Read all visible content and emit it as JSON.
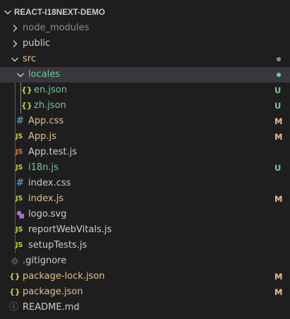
{
  "explorer": {
    "title": "REACT-I18NEXT-DEMO",
    "colors": {
      "modified": "#e2c08d",
      "untracked": "#73c991",
      "default": "#cccccc",
      "ignored": "#8c8c8c",
      "selection": "#37373d",
      "background": "#1e1e1e"
    },
    "items": [
      {
        "label": "node_modules",
        "type": "folder",
        "expanded": false,
        "icon": "chevron-right-icon",
        "status": ""
      },
      {
        "label": "public",
        "type": "folder",
        "expanded": false,
        "icon": "chevron-right-icon",
        "status": ""
      },
      {
        "label": "src",
        "type": "folder",
        "expanded": true,
        "icon": "chevron-down-icon",
        "status": "dot"
      },
      {
        "label": "locales",
        "type": "folder",
        "expanded": true,
        "icon": "chevron-down-icon",
        "status": "dot"
      },
      {
        "label": "en.json",
        "type": "file",
        "icon": "json-icon",
        "icon_text": "{}",
        "status": "U"
      },
      {
        "label": "zh.json",
        "type": "file",
        "icon": "json-icon",
        "icon_text": "{}",
        "status": "U"
      },
      {
        "label": "App.css",
        "type": "file",
        "icon": "css-icon",
        "icon_text": "#",
        "status": "M"
      },
      {
        "label": "App.js",
        "type": "file",
        "icon": "javascript-icon",
        "icon_text": "JS",
        "status": "M"
      },
      {
        "label": "App.test.js",
        "type": "file",
        "icon": "test-js-icon",
        "icon_text": "JS",
        "status": ""
      },
      {
        "label": "i18n.js",
        "type": "file",
        "icon": "javascript-icon",
        "icon_text": "JS",
        "status": "U"
      },
      {
        "label": "index.css",
        "type": "file",
        "icon": "css-icon",
        "icon_text": "#",
        "status": ""
      },
      {
        "label": "index.js",
        "type": "file",
        "icon": "javascript-icon",
        "icon_text": "JS",
        "status": "M"
      },
      {
        "label": "logo.svg",
        "type": "file",
        "icon": "svg-icon",
        "icon_text": "",
        "status": ""
      },
      {
        "label": "reportWebVitals.js",
        "type": "file",
        "icon": "javascript-icon",
        "icon_text": "JS",
        "status": ""
      },
      {
        "label": "setupTests.js",
        "type": "file",
        "icon": "javascript-icon",
        "icon_text": "JS",
        "status": ""
      },
      {
        "label": ".gitignore",
        "type": "file",
        "icon": "git-icon",
        "icon_text": "",
        "status": ""
      },
      {
        "label": "package-lock.json",
        "type": "file",
        "icon": "json-icon",
        "icon_text": "{}",
        "status": "M"
      },
      {
        "label": "package.json",
        "type": "file",
        "icon": "json-icon",
        "icon_text": "{}",
        "status": "M"
      },
      {
        "label": "README.md",
        "type": "file",
        "icon": "info-icon",
        "icon_text": "ⓘ",
        "status": ""
      }
    ]
  }
}
